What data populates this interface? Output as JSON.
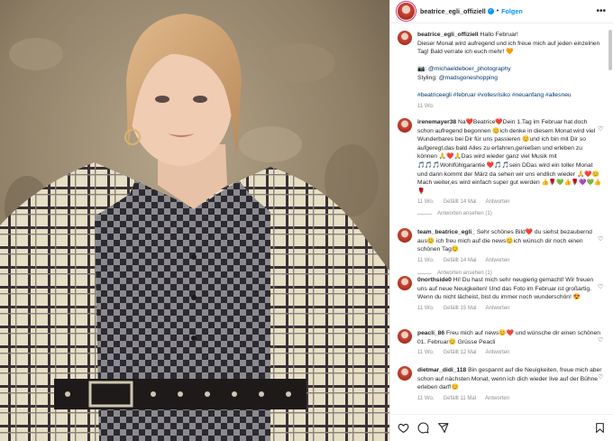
{
  "header": {
    "username": "beatrice_egli_offiziell",
    "separator": "•",
    "follow_label": "Folgen",
    "more_label": "•••"
  },
  "caption": {
    "username": "beatrice_egli_offiziell",
    "line1": "Hallo Februar!",
    "line2": "Dieser Monat wird aufregend und ich freue mich auf jeden einzelnen Tag! Bald verrate ich euch mehr! 🧡",
    "photo_prefix": "📷: ",
    "photo_credit": "@michaeldeboer_photography",
    "styling_prefix": "Styling: ",
    "styling_credit": "@madsgoneshopping",
    "hashtags": "#beatriceegli #februar #vollesrisiko #neuanfang #allesneu",
    "time": "11 Wo."
  },
  "comments": [
    {
      "username": "irenemayer38",
      "text": "Na❤️Beatrice❤️Dein 1.Tag im Februar hat doch schon aufregend begonnen 😊ich denke in diesem Monat wird viel Wunderbares bei Dir für uns passieren 😊und ich bin mit Dir so aufgeregt,das bald Alles zu erfahren,genießen und erleben zu können 🙏❤️🙏Das wird wieder ganz viel Musik mit 🎵🎵🎵Wohlfühlgarantie ❤️🎵🎵sein DDas wird ein toller Monat und dann kommt der März da sehen wir uns endlich wieder 🙏❤️😊Mach weiter,es wird einfach super gut werden 👍🌹💚👍🌹💜💚👍🌹",
      "time": "11 Wo.",
      "likes": "Gefällt 14 Mal",
      "reply": "Antworten",
      "replies": "Antworten ansehen (1)"
    },
    {
      "username": "team_beatrice_egli_",
      "text": "Sehr schönes Bild❤️ du siehst bezaubernd aus😊 ich freu mich auf die news😊ich wünsch dir noch einen schönen Tag😊",
      "time": "11 Wo.",
      "likes": "Gefällt 14 Mal",
      "reply": "Antworten",
      "replies": "Antworten ansehen (1)"
    },
    {
      "username": "0northside0",
      "text": "Hi! Du hast mich sehr neugierig gemacht! Wir freuen uns auf neue Neuigkeiten! Und das Foto im Februar ist großartig. Wenn du nicht lächeist, bist du immer noch wunderschön! 😍",
      "time": "11 Wo.",
      "likes": "Gefällt 15 Mal",
      "reply": "Antworten"
    },
    {
      "username": "peacli_86",
      "text": "Freu mich auf news😊❤️ und wünsche dir einen schönen 01. Februar😊 Grüsse Peacli",
      "time": "11 Wo.",
      "likes": "Gefällt 12 Mal",
      "reply": "Antworten"
    },
    {
      "username": "dietmar_didi_118",
      "text": "Bin gespannt auf die Neuigkeiten, freue mich aber schon auf nächsten Monat, wenn ich dich wieder live auf der Bühne erleben darf!😊",
      "time": "11 Wo.",
      "likes": "Gefällt 11 Mal",
      "reply": "Antworten"
    }
  ],
  "icons": {
    "more": "more-options-icon",
    "like": "heart-icon",
    "comment": "comment-icon",
    "share": "paper-plane-icon",
    "save": "bookmark-icon"
  },
  "colors": {
    "accent": "#0095f6",
    "link": "#00376b",
    "muted": "#8e8e8e"
  }
}
